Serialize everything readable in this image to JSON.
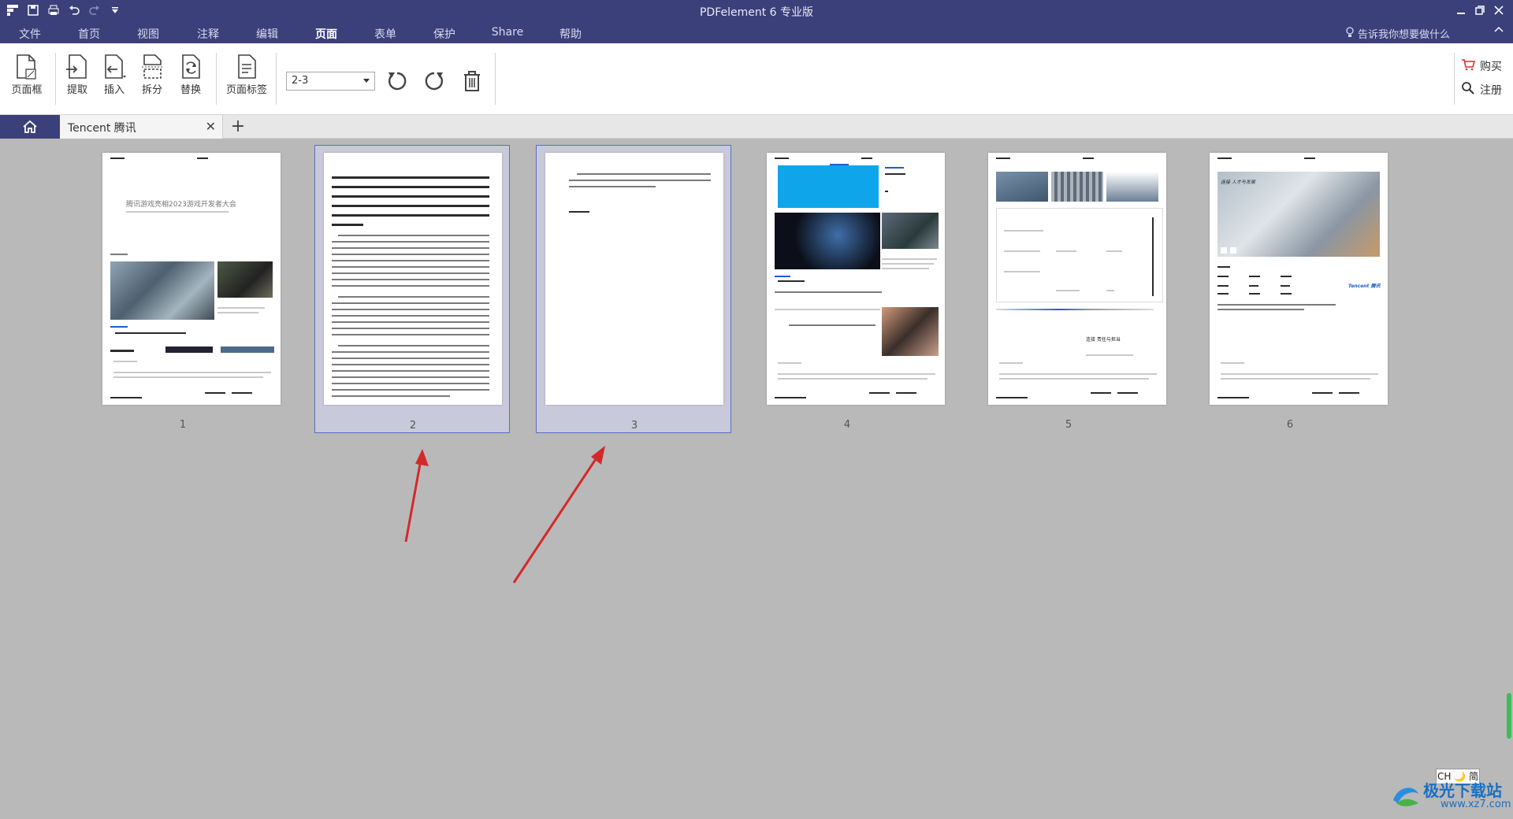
{
  "app": {
    "title": "PDFelement 6 专业版"
  },
  "menu": {
    "items": [
      {
        "label": "文件"
      },
      {
        "label": "首页"
      },
      {
        "label": "视图"
      },
      {
        "label": "注释"
      },
      {
        "label": "编辑"
      },
      {
        "label": "页面"
      },
      {
        "label": "表单"
      },
      {
        "label": "保护"
      },
      {
        "label": "Share"
      },
      {
        "label": "帮助"
      }
    ],
    "active": "页面",
    "tell_me": "告诉我你想要做什么"
  },
  "ribbon": {
    "page_box": "页面框",
    "extract": "提取",
    "insert": "插入",
    "split": "拆分",
    "replace": "替换",
    "page_label": "页面标签",
    "page_range": "2-3",
    "buy": "购买",
    "register": "注册"
  },
  "tabs": {
    "document": "Tencent 腾讯"
  },
  "pages": {
    "numbers": [
      "1",
      "2",
      "3",
      "4",
      "5",
      "6"
    ],
    "selected": [
      "2",
      "3"
    ],
    "page1_heading": "腾讯游戏亮相2023游戏开发者大会",
    "page5_heading": "连接 责任与担当",
    "page6_heading": "连接 人才与发展",
    "page6_brand": "Tencent 腾讯"
  },
  "status": {
    "ime": "CH 🌙 简"
  },
  "watermark": {
    "name": "极光下载站",
    "url": "www.xz7.com"
  },
  "colors": {
    "titlebar": "#3b3f7a",
    "workspace": "#b9b9b9",
    "selection": "#c8c9da",
    "annotation_arrow": "#d22a2a"
  }
}
